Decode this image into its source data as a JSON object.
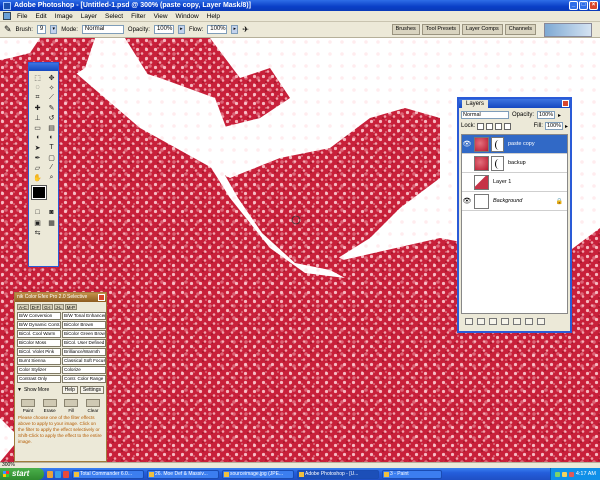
{
  "window": {
    "title": "Adobe Photoshop - [Untitled-1.psd @ 300% (paste copy, Layer Mask/8)]"
  },
  "menu": [
    "File",
    "Edit",
    "Image",
    "Layer",
    "Select",
    "Filter",
    "View",
    "Window",
    "Help"
  ],
  "options": {
    "brush_label": "Brush:",
    "brush_size": "9",
    "mode_label": "Mode:",
    "mode_value": "Normal",
    "opacity_label": "Opacity:",
    "opacity_value": "100%",
    "flow_label": "Flow:",
    "flow_value": "100%"
  },
  "palette_well": [
    "Brushes",
    "Tool Presets",
    "Layer Comps",
    "Channels"
  ],
  "colors": {
    "foreground": "#000000",
    "background": "#ffffff",
    "xp_blue": "#245edb",
    "selection": "#3169c6"
  },
  "layers_panel": {
    "tab": "Layers",
    "blend_mode": "Normal",
    "opacity_label": "Opacity:",
    "opacity_value": "100%",
    "lock_label": "Lock:",
    "fill_label": "Fill:",
    "fill_value": "100%",
    "layers": [
      {
        "name": "paste copy",
        "visible": true,
        "active": true,
        "thumb": "red",
        "has_mask": true
      },
      {
        "name": "backup",
        "visible": false,
        "active": false,
        "thumb": "red",
        "has_mask": true
      },
      {
        "name": "Layer 1",
        "visible": false,
        "active": false,
        "thumb": "redpatch",
        "has_mask": false
      },
      {
        "name": "Background",
        "visible": true,
        "active": false,
        "thumb": "white",
        "has_mask": false,
        "locked": true
      }
    ]
  },
  "nik_panel": {
    "title": "nik Color Efex Pro 2.0 Selective",
    "filters": [
      [
        "B/W Conversion",
        "B/W Tonal Enhancer"
      ],
      [
        "B/W Dynamic Contr.",
        "BiColor Brown"
      ],
      [
        "BiCol. Cool Warm",
        "BiColor Green Brown"
      ],
      [
        "BiColor Moss",
        "BiCol. User Defined"
      ],
      [
        "BiCol. Violet Pink",
        "Brilliance/Warmth"
      ],
      [
        "Burnt Sienna",
        "Classical Soft Focus"
      ],
      [
        "Color Stylizer",
        "Colorize"
      ],
      [
        "Contrast Only",
        "Contr. Color Range"
      ]
    ],
    "show_more": "Show More",
    "help": "Help",
    "settings": "Settings",
    "actions": [
      "Paint",
      "Erase",
      "Fill",
      "Clear"
    ],
    "help_text": "Please choose one of the filter effects above to apply to your image. Click on the filter to apply the effect selectively or Shift-Click to apply the effect to the entire image."
  },
  "status": {
    "zoom": "300%"
  },
  "taskbar": {
    "start": "start",
    "tasks": [
      "Total Commander 6.0...",
      "26. Moe Def & Massiv...",
      "sourceimage.jpg (JPE...",
      "Adobe Photoshop - [U...",
      "3 - Paint"
    ],
    "active_task_index": 3,
    "clock": "4:17 AM"
  }
}
